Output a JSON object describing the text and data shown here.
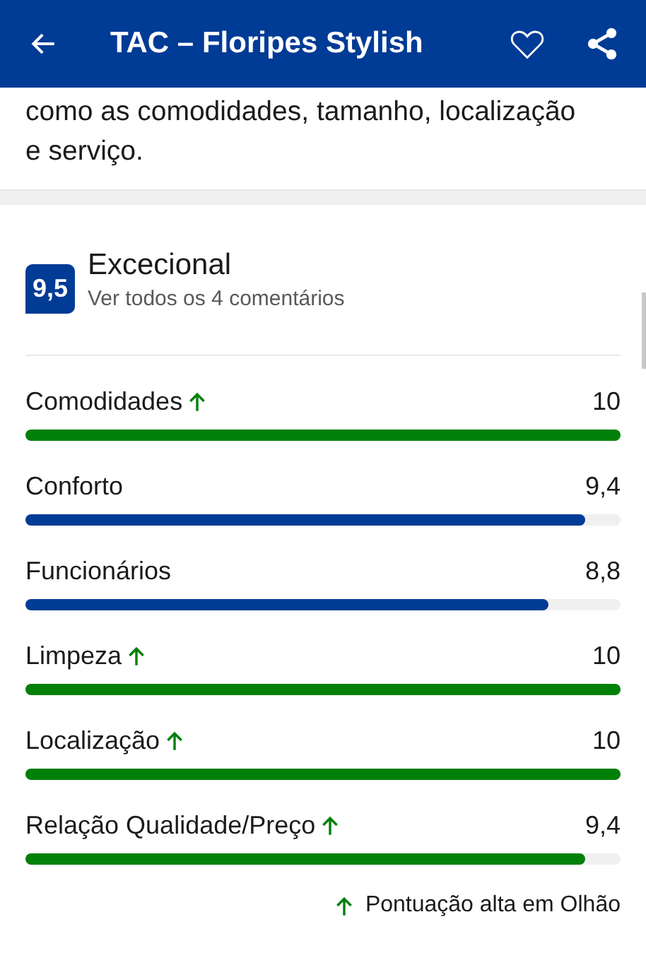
{
  "header": {
    "title": "TAC – Floripes Stylish"
  },
  "description": "como as comodidades, tamanho, localização e serviço.",
  "rating": {
    "score": "9,5",
    "label": "Excecional",
    "reviews_link": "Ver todos os 4 comentários"
  },
  "categories": [
    {
      "name": "Comodidades",
      "score": "10",
      "high": true,
      "level": 1.0
    },
    {
      "name": "Conforto",
      "score": "9,4",
      "high": false,
      "level": 0.94
    },
    {
      "name": "Funcionários",
      "score": "8,8",
      "high": false,
      "level": 0.88
    },
    {
      "name": "Limpeza",
      "score": "10",
      "high": true,
      "level": 1.0
    },
    {
      "name": "Localização",
      "score": "10",
      "high": true,
      "level": 1.0
    },
    {
      "name": "Relação Qualidade/Preço",
      "score": "9,4",
      "high": true,
      "level": 0.94
    }
  ],
  "legend": "Pontuação alta em Olhão"
}
